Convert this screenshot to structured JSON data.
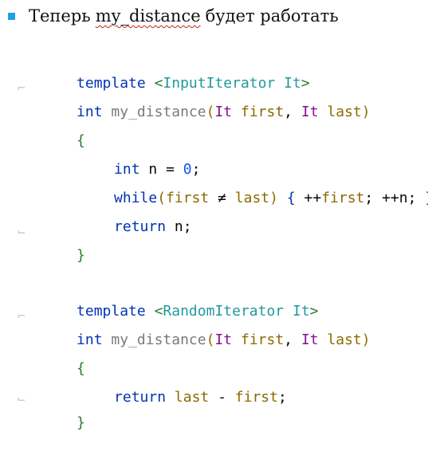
{
  "slide": {
    "bullet_before": "Теперь",
    "bullet_function": "my_distance",
    "bullet_after": "будет работать",
    "bullet_color": "#1fa3e0"
  },
  "code": {
    "block1": {
      "line1": {
        "kw": "template",
        "open": "<",
        "type": "InputIterator",
        "name": "It",
        "close": ">"
      },
      "line2": {
        "ret": "int",
        "fn": "my_distance",
        "lp": "(",
        "t1": "It",
        "p1": "first",
        "comma": ",",
        "t2": "It",
        "p2": "last",
        "rp": ")"
      },
      "line3": {
        "brace": "{"
      },
      "line4": {
        "kw": "int",
        "var": "n",
        "eq": "=",
        "val": "0",
        "semi": ";"
      },
      "line5": {
        "kw": "while",
        "lp": "(",
        "a": "first",
        "neq": "≠",
        "b": "last",
        "rp": ")",
        "lb": "{",
        "inc1": "++",
        "first": "first",
        "semi1": ";",
        "inc2": "++",
        "n": "n",
        "semi2": ";",
        "rb": "}"
      },
      "line6": {
        "kw": "return",
        "val": "n",
        "semi": ";"
      },
      "line7": {
        "brace": "}"
      }
    },
    "block2": {
      "line1": {
        "kw": "template",
        "open": "<",
        "type": "RandomIterator",
        "name": "It",
        "close": ">"
      },
      "line2": {
        "ret": "int",
        "fn": "my_distance",
        "lp": "(",
        "t1": "It",
        "p1": "first",
        "comma": ",",
        "t2": "It",
        "p2": "last",
        "rp": ")"
      },
      "line3": {
        "brace": "{"
      },
      "line4": {
        "kw": "return",
        "a": "last",
        "minus": "-",
        "b": "first",
        "semi": ";"
      },
      "line5": {
        "brace": "}"
      }
    }
  },
  "colors": {
    "keyword": "#0033b3",
    "type_param": "#20999d",
    "function_name": "#7a7a7a",
    "parameter": "#8c6a00",
    "number": "#1750eb",
    "brace": "#2f7b2f"
  }
}
